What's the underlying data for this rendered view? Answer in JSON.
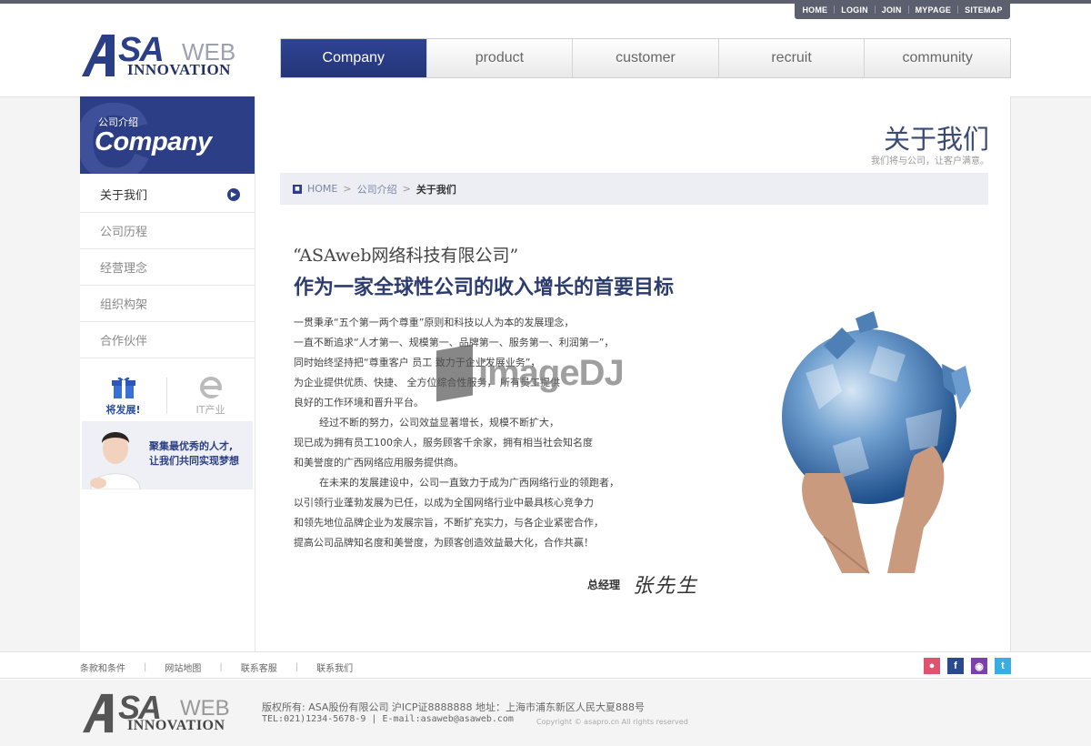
{
  "topnav": [
    "HOME",
    "LOGIN",
    "JOIN",
    "MYPAGE",
    "SITEMAP"
  ],
  "logo": {
    "sa": "SA",
    "web": "WEB",
    "innovation": "INNOVATION"
  },
  "mainnav": [
    "Company",
    "product",
    "customer",
    "recruit",
    "community"
  ],
  "sidebar": {
    "head_cn": "公司介绍",
    "head_en": "Company",
    "items": [
      "关于我们",
      "公司历程",
      "经营理念",
      "组织构架",
      "合作伙伴"
    ],
    "icon1": "将发展!",
    "icon2": "IT产业",
    "banner_line1": "聚集最优秀的人才,",
    "banner_line2": "让我们共同实现梦想"
  },
  "page": {
    "title": "关于我们",
    "subtitle": "我们将与公司，让客户满意。",
    "breadcrumb": {
      "home": "HOME",
      "section": "公司介绍",
      "current": "关于我们"
    },
    "quote1": "“ASAweb网络科技有限公司”",
    "quote2": "作为一家全球性公司的收入增长的首要目标",
    "lines": [
      "一贯秉承“五个第一两个尊重”原则和科技以人为本的发展理念，",
      "一直不断追求“人才第一、规模第一、品牌第一、服务第一、利润第一”，",
      "同时始终坚持把“尊重客户      员工      致力于企业发展业务”，",
      "为企业提供优质、快捷、     全方位综合性服务，      所有员工提供",
      "良好的工作环境和晋升平台。",
      "经过不断的努力，公司效益显著增长，规模不断扩大，",
      "现已成为拥有员工100余人，服务顾客千余家，拥有相当社会知名度",
      "和美誉度的广西网络应用服务提供商。",
      "在未来的发展建设中，公司一直致力于成为广西网络行业的领跑者，",
      "以引领行业蓬勃发展为已任，以成为全国网络行业中最具核心竞争力",
      "和领先地位品牌企业为发展宗旨，不断扩充实力，与各企业紧密合作，",
      "提高公司品牌知名度和美誉度，为顾客创造效益最大化，合作共赢！"
    ],
    "sign_title": "总经理",
    "sign_name": "张先生",
    "watermark": "imageDJ"
  },
  "footer": {
    "links": [
      "条款和条件",
      "网站地图",
      "联系客服",
      "联系我们"
    ],
    "info1": "版权所有: ASA股份有限公司 沪ICP证8888888 地址：上海市浦东新区人民大夏888号",
    "info2": "TEL:021)1234-5678-9 | E-mail:asaweb@asaweb.com",
    "copyright": "Copyright © asapro.cn All rights reserved",
    "social": [
      "weibo-icon",
      "facebook-icon",
      "qq-icon",
      "twitter-icon"
    ]
  },
  "colors": {
    "brand": "#2c3f86",
    "topbar": "#5b5f6e"
  }
}
